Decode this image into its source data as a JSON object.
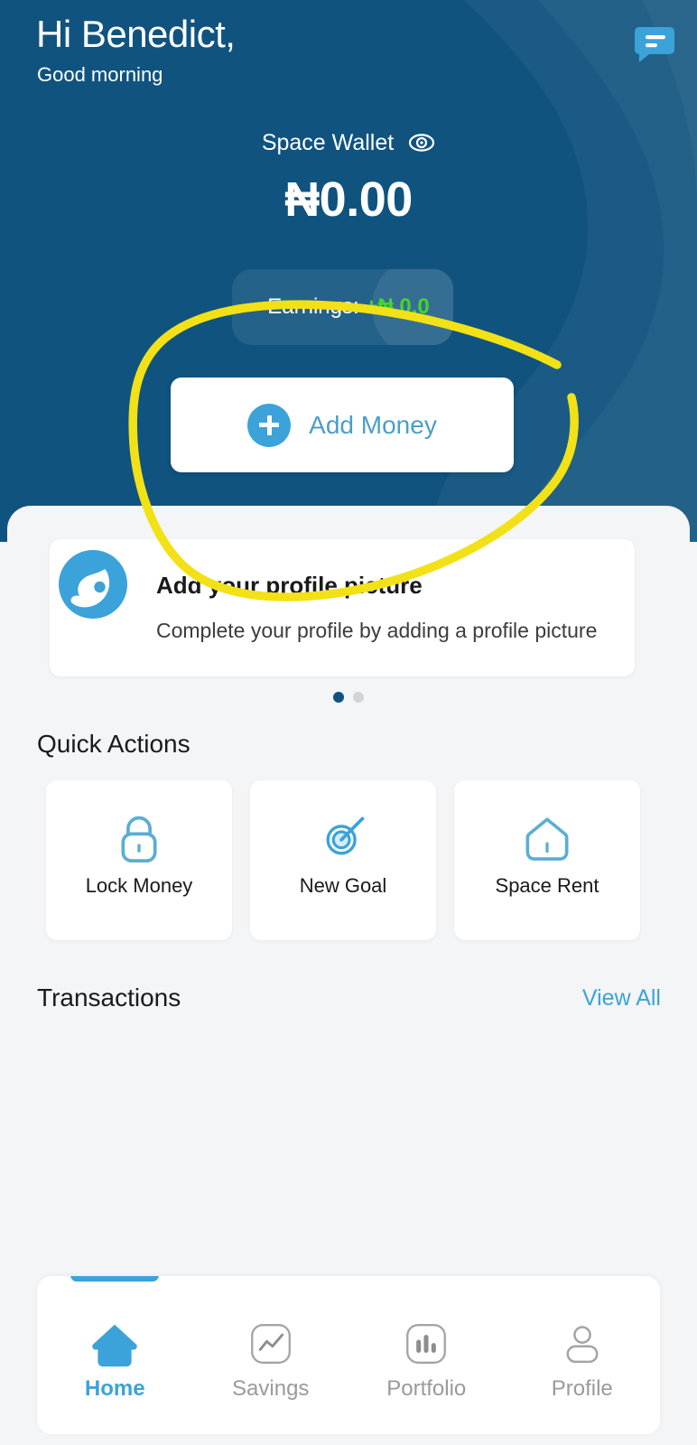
{
  "header": {
    "greeting_name": "Hi Benedict,",
    "greeting_sub": "Good morning",
    "chat_icon": "chat-bubble-icon",
    "wallet_label": "Space Wallet",
    "eye_icon": "eye-visibility-icon",
    "balance": "₦0.00",
    "earnings_prefix": "Earnings: ",
    "earnings_value": "+₦ 0.0",
    "add_money_label": "Add Money",
    "plus_icon": "plus-icon",
    "bg_color": "#10537f"
  },
  "promo": {
    "title": "Add your profile picture",
    "subtitle": "Complete your profile by adding a profile picture",
    "avatar_icon": "profile-avatar-icon",
    "dots": [
      {
        "active": true
      },
      {
        "active": false
      }
    ]
  },
  "quick_actions": {
    "title": "Quick Actions",
    "items": [
      {
        "label": "Lock Money",
        "icon": "lock-icon"
      },
      {
        "label": "New Goal",
        "icon": "target-icon"
      },
      {
        "label": "Space Rent",
        "icon": "house-icon"
      }
    ]
  },
  "transactions": {
    "title": "Transactions",
    "view_all_label": "View All",
    "items": []
  },
  "bottom_nav": {
    "items": [
      {
        "label": "Home",
        "icon": "home-icon",
        "active": true
      },
      {
        "label": "Savings",
        "icon": "line-chart-icon",
        "active": false
      },
      {
        "label": "Portfolio",
        "icon": "bar-chart-icon",
        "active": false
      },
      {
        "label": "Profile",
        "icon": "person-icon",
        "active": false
      }
    ]
  },
  "annotation": {
    "type": "hand-drawn-circle",
    "color": "#f2e116",
    "target": "Add Money"
  },
  "colors": {
    "brand_dark_blue": "#10537f",
    "brand_light_blue": "#3ba3d9",
    "accent_green": "#43d62a",
    "annotation_yellow": "#f2e116",
    "page_bg": "#f4f5f7"
  }
}
